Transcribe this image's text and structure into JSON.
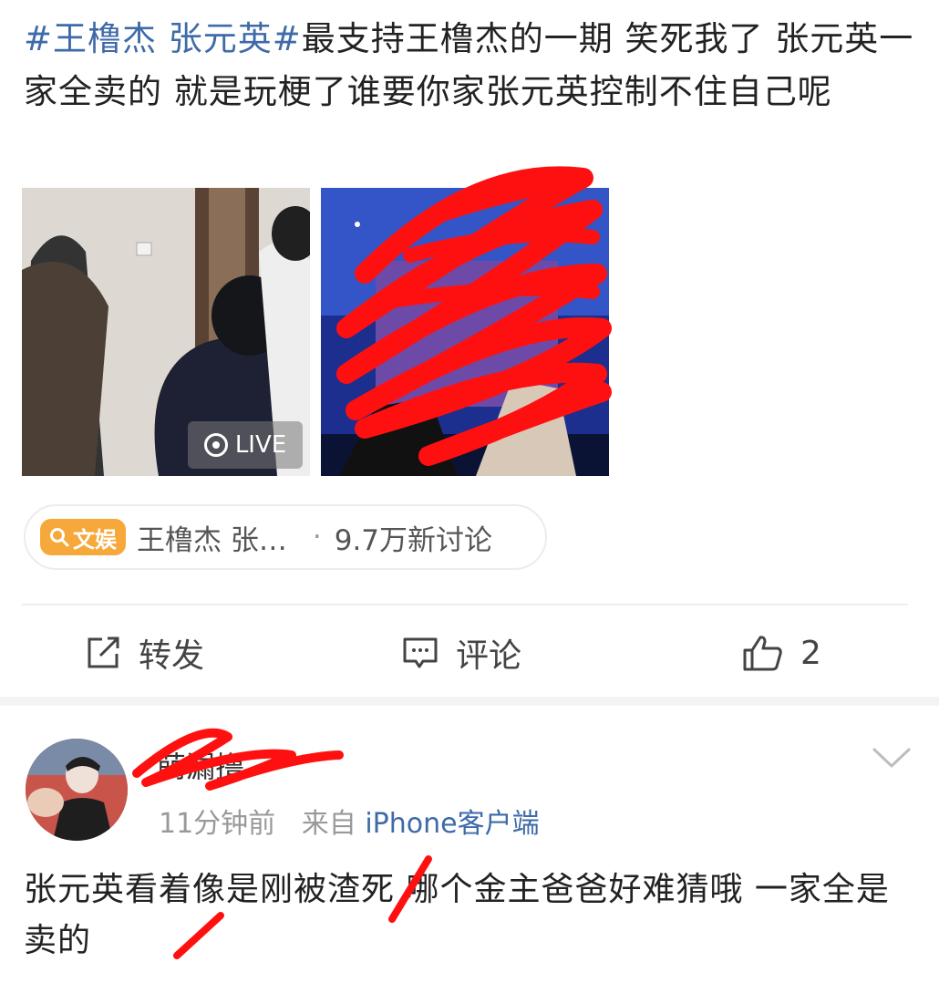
{
  "post": {
    "tag_text": "#王橹杰 张元英#",
    "body_text": "最支持王橹杰的一期 笑死我了 张元英一家全卖的 就是玩梗了谁要你家张元英控制不住自己呢"
  },
  "images": {
    "live_label": "LIVE"
  },
  "topic": {
    "badge_label": "文娱",
    "name": "王橹杰 张…",
    "separator": "·",
    "discussion_count": "9.7万新讨论"
  },
  "actions": {
    "repost_label": "转发",
    "comment_label": "评论",
    "like_count": "2"
  },
  "comment": {
    "username": "萌漏撸",
    "time": "11分钟前",
    "from_label": "来自",
    "source": "iPhone客户端",
    "text": "张元英看着像是刚被渣死 哪个金主爸爸好难猜哦 一家全是卖的"
  },
  "colors": {
    "link_blue": "#3e6aa8",
    "topic_orange": "#f7a83a",
    "scribble_red": "#ff1010"
  }
}
